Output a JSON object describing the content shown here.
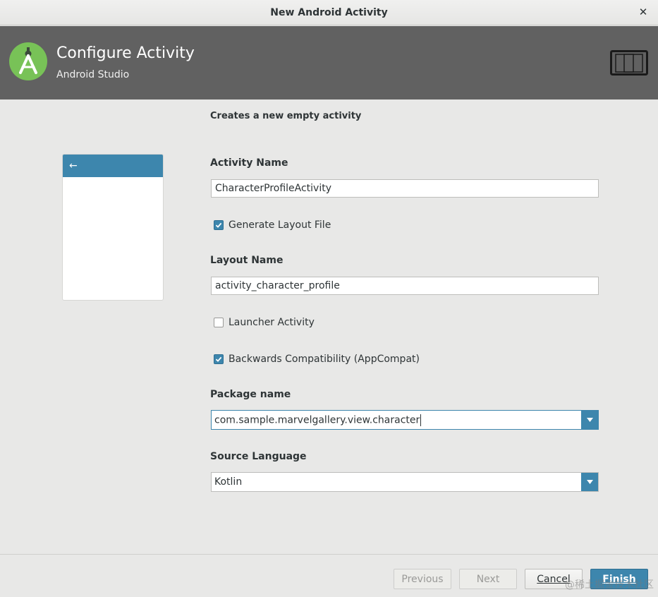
{
  "window": {
    "title": "New Android Activity"
  },
  "header": {
    "title": "Configure Activity",
    "subtitle": "Android Studio",
    "logo_icon": "android-studio-logo",
    "device_icon": "tablet-phone-icon"
  },
  "form": {
    "description": "Creates a new empty activity",
    "activity_name_label": "Activity Name",
    "activity_name_value": "CharacterProfileActivity",
    "generate_layout_label": "Generate Layout File",
    "generate_layout_checked": true,
    "layout_name_label": "Layout Name",
    "layout_name_value": "activity_character_profile",
    "launcher_label": "Launcher Activity",
    "launcher_checked": false,
    "backwards_label": "Backwards Compatibility (AppCompat)",
    "backwards_checked": true,
    "package_label": "Package name",
    "package_value": "com.sample.marvelgallery.view.character",
    "language_label": "Source Language",
    "language_value": "Kotlin"
  },
  "preview": {
    "back_icon": "arrow-left-icon"
  },
  "buttons": {
    "previous": "Previous",
    "next": "Next",
    "cancel": "Cancel",
    "finish": "Finish"
  },
  "watermark": "@稀土掘金技术社区",
  "colors": {
    "accent": "#3d86ad",
    "header_bg": "#616161",
    "logo_green": "#78c257"
  }
}
